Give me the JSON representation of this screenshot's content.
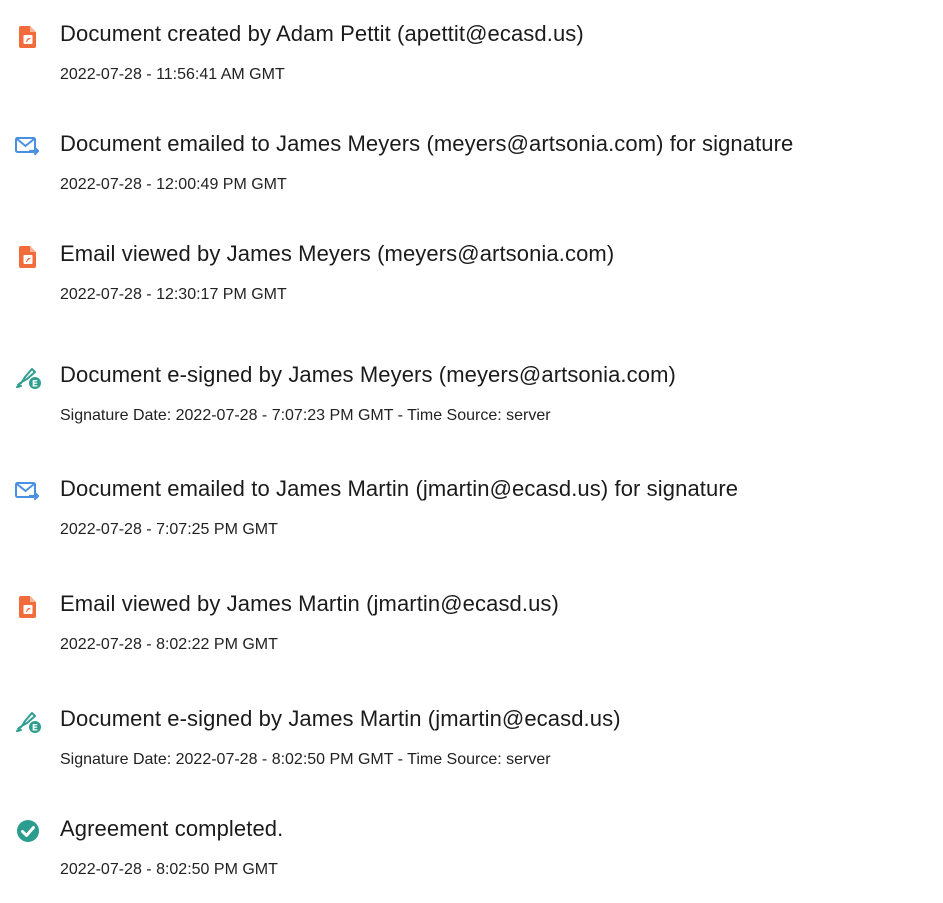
{
  "events": [
    {
      "icon": "document-created-icon",
      "title": "Document created by Adam Pettit (apettit@ecasd.us)",
      "subtitle": "2022-07-28 - 11:56:41 AM GMT"
    },
    {
      "icon": "email-sent-icon",
      "title": "Document emailed to James Meyers (meyers@artsonia.com) for signature",
      "subtitle": "2022-07-28 - 12:00:49 PM GMT"
    },
    {
      "icon": "email-viewed-icon",
      "title": "Email viewed by James Meyers (meyers@artsonia.com)",
      "subtitle": "2022-07-28 - 12:30:17 PM GMT"
    },
    {
      "icon": "esign-pen-icon",
      "title": "Document e-signed by James Meyers (meyers@artsonia.com)",
      "subtitle": "Signature Date: 2022-07-28 - 7:07:23 PM GMT - Time Source: server"
    },
    {
      "icon": "email-sent-icon",
      "title": "Document emailed to James Martin (jmartin@ecasd.us) for signature",
      "subtitle": "2022-07-28 - 7:07:25 PM GMT"
    },
    {
      "icon": "email-viewed-icon",
      "title": "Email viewed by James Martin (jmartin@ecasd.us)",
      "subtitle": "2022-07-28 - 8:02:22 PM GMT"
    },
    {
      "icon": "esign-pen-icon",
      "title": "Document e-signed by James Martin (jmartin@ecasd.us)",
      "subtitle": "Signature Date: 2022-07-28 - 8:02:50 PM GMT - Time Source: server"
    },
    {
      "icon": "check-circle-icon",
      "title": "Agreement completed.",
      "subtitle": "2022-07-28 - 8:02:50 PM GMT"
    }
  ],
  "colors": {
    "document_icon": "#f26b3a",
    "email_icon": "#4a90e2",
    "esign_icon": "#2e9e8f",
    "check_icon": "#2a9d8f"
  }
}
